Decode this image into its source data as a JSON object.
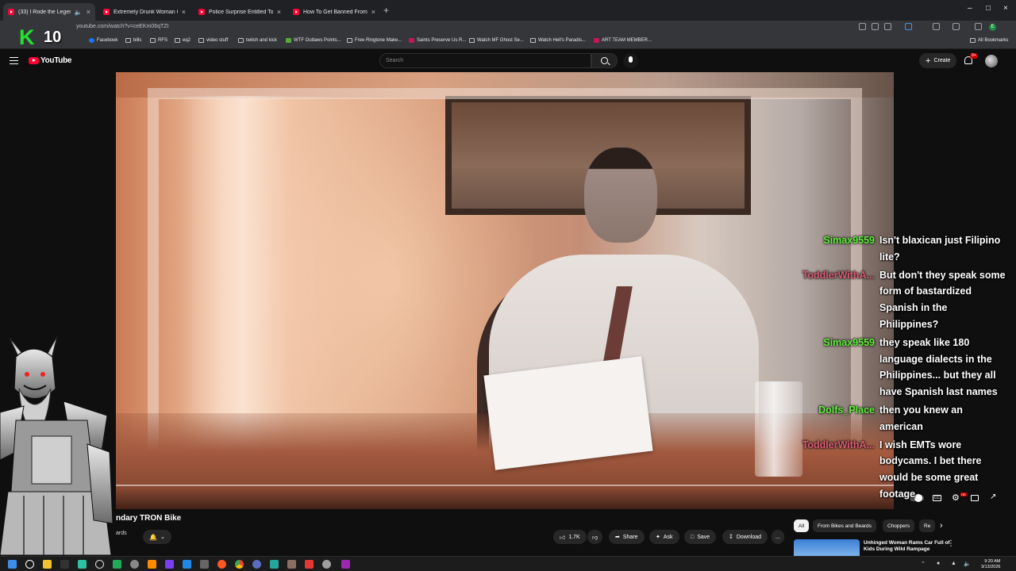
{
  "browser": {
    "tabs": [
      {
        "title": "(33) I Rode the Legendary T",
        "active": true,
        "audio": true
      },
      {
        "title": "Extremely Drunk Woman Crash",
        "active": false
      },
      {
        "title": "Police Surprise Entitled Touris",
        "active": false
      },
      {
        "title": "How To Get Banned From MGM",
        "active": false
      }
    ],
    "url": "youtube.com/watch?v=ceEKm06qTZI",
    "bookmarks": [
      {
        "label": "Facebook",
        "icon": "facebook-icon"
      },
      {
        "label": "bills",
        "icon": "folder-icon"
      },
      {
        "label": "RFS",
        "icon": "folder-icon"
      },
      {
        "label": "eq2",
        "icon": "folder-icon"
      },
      {
        "label": "video stuff",
        "icon": "folder-icon"
      },
      {
        "label": "twitch and kick",
        "icon": "folder-icon"
      },
      {
        "label": "WTF Outlaws Points...",
        "icon": "site-icon"
      },
      {
        "label": "Free Ringtone Make...",
        "icon": "site-icon"
      },
      {
        "label": "Saints Preserve Us R...",
        "icon": "site-icon"
      },
      {
        "label": "Watch MF Ghost Se...",
        "icon": "site-icon"
      },
      {
        "label": "Watch Hell's Paradis...",
        "icon": "site-icon"
      },
      {
        "label": "ART TEAM MEMBER...",
        "icon": "site-icon"
      }
    ],
    "all_bookmarks": "All Bookmarks",
    "profile_initial": "E"
  },
  "overlay": {
    "badge_letter": "K",
    "badge_count": "10"
  },
  "youtube": {
    "logo_text": "YouTube",
    "search_placeholder": "Search",
    "create_label": "Create",
    "notif_count": "9+"
  },
  "chat": [
    {
      "user": "Simax9559",
      "color": "green",
      "text": "Isn't blaxican just Filipino lite?"
    },
    {
      "user": "ToddlerWithA...",
      "color": "pink",
      "text": "But don't they speak some form of bastardized Spanish in the Philippines?"
    },
    {
      "user": "Simax9559",
      "color": "green",
      "text": "they speak like 180 language dialects in the Philippines... but they all have Spanish last names"
    },
    {
      "user": "Dolfs_Place",
      "color": "green",
      "text": "then you knew an american"
    },
    {
      "user": "ToddlerWithA...",
      "color": "pink",
      "text": "I wish EMTs wore bodycams. I bet there would be some great footage"
    }
  ],
  "video": {
    "title_visible": "ndary TRON Bike",
    "channel_partial": "ards",
    "likes": "1.7K",
    "share_label": "Share",
    "ask_label": "Ask",
    "save_label": "Save",
    "download_label": "Download",
    "more_label": "...",
    "subscriber_partial": "2"
  },
  "recommendations": {
    "chips": [
      "All",
      "From Bikes and Beards",
      "Choppers",
      "Re"
    ],
    "items": [
      {
        "title": "Unhinged Woman Rams Car Full of Kids During Wild Rampage"
      }
    ]
  },
  "taskbar": {
    "time": "9:20 AM",
    "date": "3/13/2026"
  }
}
